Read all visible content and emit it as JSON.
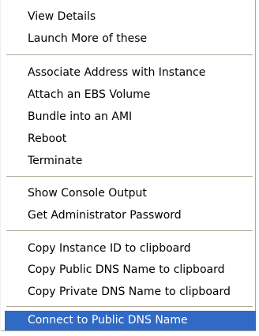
{
  "context_menu": {
    "selection_color": "#316ac5",
    "groups": [
      {
        "items": [
          {
            "label": "View Details"
          },
          {
            "label": "Launch More of these"
          }
        ]
      },
      {
        "items": [
          {
            "label": "Associate Address with Instance"
          },
          {
            "label": "Attach an EBS Volume"
          },
          {
            "label": "Bundle into an AMI"
          },
          {
            "label": "Reboot"
          },
          {
            "label": "Terminate"
          }
        ]
      },
      {
        "items": [
          {
            "label": "Show Console Output"
          },
          {
            "label": "Get Administrator Password"
          }
        ]
      },
      {
        "items": [
          {
            "label": "Copy Instance ID to clipboard"
          },
          {
            "label": "Copy Public DNS Name to clipboard"
          },
          {
            "label": "Copy Private DNS Name to clipboard"
          }
        ]
      },
      {
        "items": [
          {
            "label": "Connect to Public DNS Name",
            "selected": true
          }
        ]
      }
    ]
  }
}
